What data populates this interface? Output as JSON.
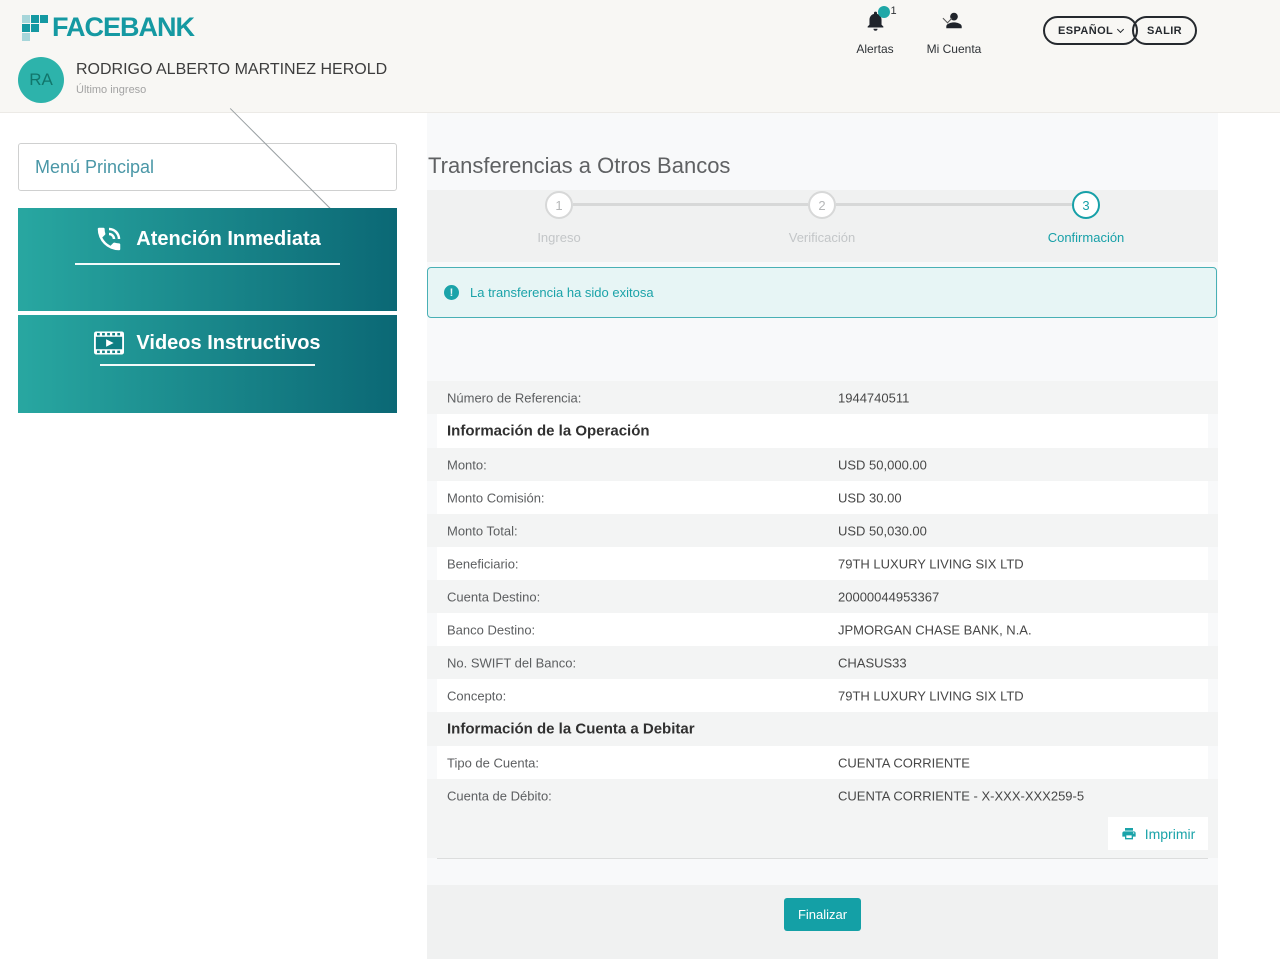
{
  "header": {
    "brand": "FACEBANK",
    "alerts_label": "Alertas",
    "alerts_badge": "1",
    "account_label": "Mi Cuenta",
    "language_button": "ESPAÑOL",
    "logout_button": "SALIR",
    "user": {
      "initials": "RA",
      "name": "RODRIGO ALBERTO MARTINEZ HEROLD",
      "last_login_label": "Último ingreso"
    }
  },
  "sidebar": {
    "menu_select": "Menú Principal",
    "cards": [
      {
        "label": "Atención Inmediata",
        "icon": "phone-icon"
      },
      {
        "label": "Videos Instructivos",
        "icon": "video-icon"
      }
    ]
  },
  "main": {
    "title": "Transferencias a Otros Bancos",
    "stepper": [
      {
        "number": "1",
        "label": "Ingreso",
        "state": "inactive"
      },
      {
        "number": "2",
        "label": "Verificación",
        "state": "inactive"
      },
      {
        "number": "3",
        "label": "Confirmación",
        "state": "active"
      }
    ],
    "alert": {
      "text": "La transferencia ha sido exitosa"
    },
    "details": [
      {
        "type": "row",
        "label": "Número de Referencia:",
        "value": "1944740511"
      },
      {
        "type": "section",
        "label": "Información de la Operación"
      },
      {
        "type": "row",
        "label": "Monto:",
        "value": "USD 50,000.00"
      },
      {
        "type": "row",
        "label": "Monto Comisión:",
        "value": "USD 30.00"
      },
      {
        "type": "row",
        "label": "Monto Total:",
        "value": "USD 50,030.00"
      },
      {
        "type": "row",
        "label": "Beneficiario:",
        "value": "79TH LUXURY LIVING SIX LTD"
      },
      {
        "type": "row",
        "label": "Cuenta Destino:",
        "value": "20000044953367"
      },
      {
        "type": "row",
        "label": "Banco Destino:",
        "value": "JPMORGAN CHASE BANK, N.A."
      },
      {
        "type": "row",
        "label": "No. SWIFT del Banco:",
        "value": "CHASUS33"
      },
      {
        "type": "row",
        "label": "Concepto:",
        "value": "79TH LUXURY LIVING SIX LTD"
      },
      {
        "type": "section",
        "label": "Información de la Cuenta a Debitar"
      },
      {
        "type": "row",
        "label": "Tipo de Cuenta:",
        "value": "CUENTA CORRIENTE"
      },
      {
        "type": "row",
        "label": "Cuenta de Débito:",
        "value": "CUENTA CORRIENTE - X-XXX-XXX259-5"
      }
    ],
    "print_button": "Imprimir",
    "finish_button": "Finalizar"
  },
  "colors": {
    "accent_teal": "#17a0a8",
    "brand_teal": "#1599a2",
    "card_gradient_start": "#28a7a1",
    "card_gradient_end": "#0b6875",
    "finalize_button": "#14a0a6",
    "avatar_bg": "#2db3ab",
    "alert_bg": "#e7f5f5",
    "alert_border": "#49b0b5"
  }
}
